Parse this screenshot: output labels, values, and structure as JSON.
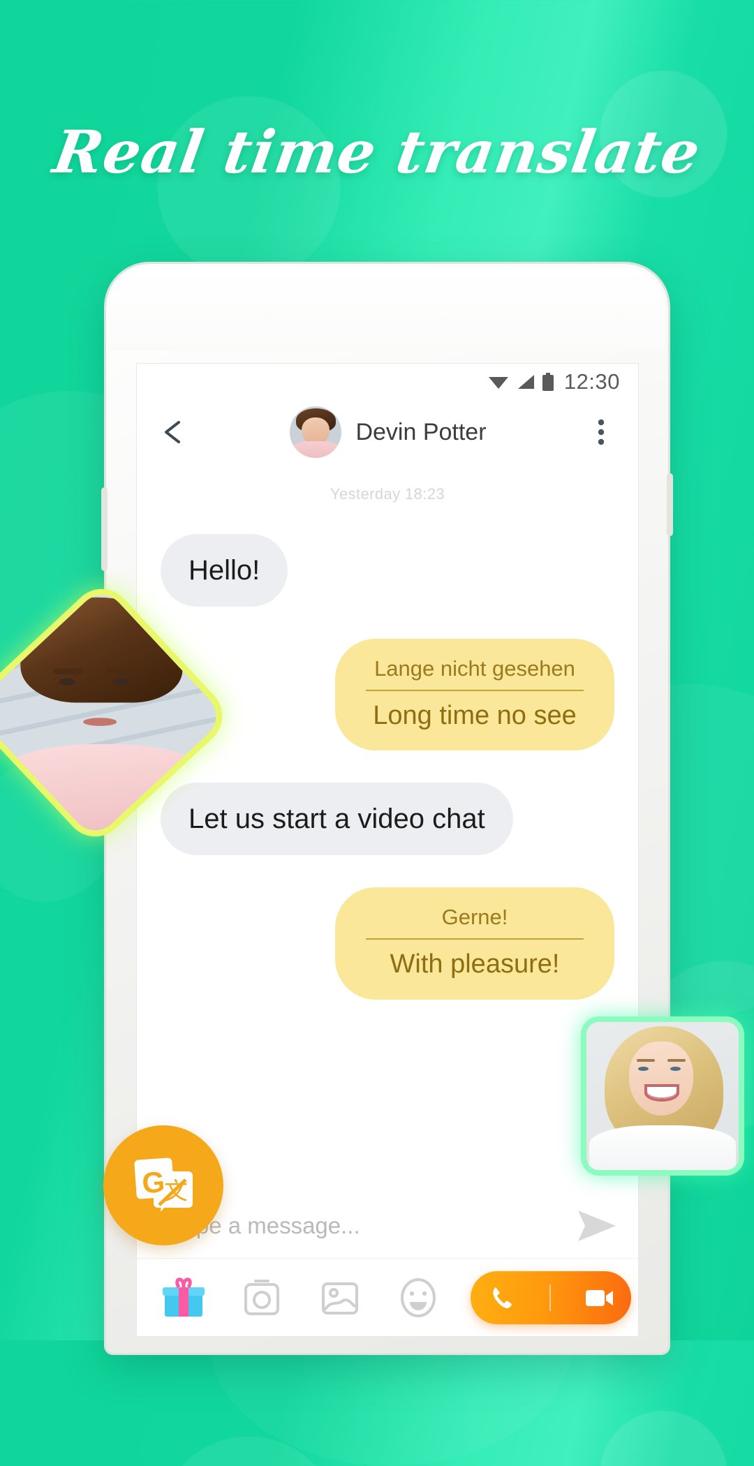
{
  "promo": {
    "headline": "Real time translate",
    "background_start": "#10d69b",
    "background_mid": "#41f0bd",
    "background_end": "#0fd49a"
  },
  "status_bar": {
    "time": "12:30",
    "icons": [
      "wifi-icon",
      "signal-icon",
      "battery-icon"
    ]
  },
  "app_bar": {
    "back_icon": "back-arrow-icon",
    "contact_name": "Devin Potter",
    "menu_icon": "overflow-menu-icon"
  },
  "conversation": {
    "daystamp": "Yesterday 18:23",
    "messages": [
      {
        "side": "in",
        "text": "Hello!"
      },
      {
        "side": "out",
        "source": "Lange nicht gesehen",
        "translation": "Long time no see"
      },
      {
        "side": "in",
        "text": "Let us start a video chat"
      },
      {
        "side": "out",
        "source": "Gerne!",
        "translation": "With pleasure!"
      }
    ]
  },
  "composer": {
    "placeholder": "Type a message...",
    "send_icon": "send-icon",
    "translate_fab": "google-translate-icon"
  },
  "toolbar": {
    "items": [
      {
        "name": "gift-icon",
        "label": "Gift"
      },
      {
        "name": "camera-icon",
        "label": "Camera"
      },
      {
        "name": "image-icon",
        "label": "Image"
      },
      {
        "name": "emoji-icon",
        "label": "Emoji"
      }
    ],
    "call_pill": {
      "voice_icon": "phone-icon",
      "video_icon": "video-camera-icon",
      "gradient_start": "#ffaf12",
      "gradient_end": "#fb6a10"
    }
  },
  "video_thumbs": [
    {
      "name": "self-video-thumb-male",
      "glow": "#e9f76b"
    },
    {
      "name": "peer-video-thumb-female",
      "glow": "#8dfbc0"
    }
  ],
  "colors": {
    "bubble_in_bg": "#eceef1",
    "bubble_out_bg": "#fae79a",
    "translate_accent": "#8f6e11",
    "fab_orange": "#f5a91a"
  }
}
